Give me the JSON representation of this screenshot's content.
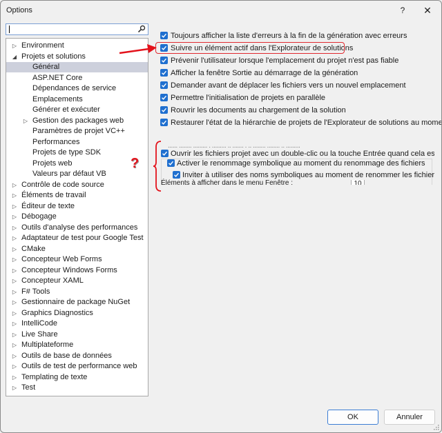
{
  "window": {
    "title": "Options",
    "help_label": "?",
    "close_label": "✕"
  },
  "search": {
    "value": "",
    "placeholder": "",
    "icon": "search-icon"
  },
  "tree": {
    "items": [
      {
        "label": "Environment",
        "level": 0,
        "expander": "collapsed"
      },
      {
        "label": "Projets et solutions",
        "level": 0,
        "expander": "expanded"
      },
      {
        "label": "Général",
        "level": 1,
        "expander": "none",
        "selected": true
      },
      {
        "label": "ASP.NET Core",
        "level": 1,
        "expander": "none"
      },
      {
        "label": "Dépendances de service",
        "level": 1,
        "expander": "none"
      },
      {
        "label": "Emplacements",
        "level": 1,
        "expander": "none"
      },
      {
        "label": "Générer et exécuter",
        "level": 1,
        "expander": "none"
      },
      {
        "label": "Gestion des packages web",
        "level": 1,
        "expander": "collapsed"
      },
      {
        "label": "Paramètres de projet VC++",
        "level": 1,
        "expander": "none"
      },
      {
        "label": "Performances",
        "level": 1,
        "expander": "none"
      },
      {
        "label": "Projets de type SDK",
        "level": 1,
        "expander": "none"
      },
      {
        "label": "Projets web",
        "level": 1,
        "expander": "none"
      },
      {
        "label": "Valeurs par défaut VB",
        "level": 1,
        "expander": "none"
      },
      {
        "label": "Contrôle de code source",
        "level": 0,
        "expander": "collapsed"
      },
      {
        "label": "Éléments de travail",
        "level": 0,
        "expander": "collapsed"
      },
      {
        "label": "Éditeur de texte",
        "level": 0,
        "expander": "collapsed"
      },
      {
        "label": "Débogage",
        "level": 0,
        "expander": "collapsed"
      },
      {
        "label": "Outils d'analyse des performances",
        "level": 0,
        "expander": "collapsed"
      },
      {
        "label": "Adaptateur de test pour Google Test",
        "level": 0,
        "expander": "collapsed"
      },
      {
        "label": "CMake",
        "level": 0,
        "expander": "collapsed"
      },
      {
        "label": "Concepteur Web Forms",
        "level": 0,
        "expander": "collapsed"
      },
      {
        "label": "Concepteur Windows Forms",
        "level": 0,
        "expander": "collapsed"
      },
      {
        "label": "Concepteur XAML",
        "level": 0,
        "expander": "collapsed"
      },
      {
        "label": "F# Tools",
        "level": 0,
        "expander": "collapsed"
      },
      {
        "label": "Gestionnaire de package NuGet",
        "level": 0,
        "expander": "collapsed"
      },
      {
        "label": "Graphics Diagnostics",
        "level": 0,
        "expander": "collapsed"
      },
      {
        "label": "IntelliCode",
        "level": 0,
        "expander": "collapsed"
      },
      {
        "label": "Live Share",
        "level": 0,
        "expander": "collapsed"
      },
      {
        "label": "Multiplateforme",
        "level": 0,
        "expander": "collapsed"
      },
      {
        "label": "Outils de base de données",
        "level": 0,
        "expander": "collapsed"
      },
      {
        "label": "Outils de test de performance web",
        "level": 0,
        "expander": "collapsed"
      },
      {
        "label": "Templating de texte",
        "level": 0,
        "expander": "collapsed"
      },
      {
        "label": "Test",
        "level": 0,
        "expander": "collapsed"
      }
    ]
  },
  "options": [
    {
      "label": "Toujours afficher la liste d'erreurs à la fin de la génération avec erreurs",
      "checked": true
    },
    {
      "label": "Suivre un élément actif dans l'Explorateur de solutions",
      "checked": true,
      "highlighted": true
    },
    {
      "label": "Prévenir l'utilisateur lorsque l'emplacement du projet n'est pas fiable",
      "checked": true
    },
    {
      "label": "Afficher la fenêtre Sortie au démarrage de la génération",
      "checked": true
    },
    {
      "label": "Demander avant de déplacer les fichiers vers un nouvel emplacement",
      "checked": true
    },
    {
      "label": "Permettre l'initialisation de projets en parallèle",
      "checked": true
    },
    {
      "label": "Rouvrir les documents au chargement de la solution",
      "checked": true
    },
    {
      "label": "Restaurer l'état de la hiérarchie de projets de l'Explorateur de solutions au moment du",
      "checked": true
    }
  ],
  "inner_panel": {
    "garbled_text": "...... ........ ......... . ......... .. ....... . .. ........ ........ .. .........",
    "options": [
      {
        "label": "Ouvrir les fichiers projet avec un double-clic ou la touche Entrée quand cela est pris e",
        "checked": true
      },
      {
        "label": "Activer le renommage symbolique au moment du renommage des fichiers",
        "checked": true
      },
      {
        "label": "Inviter à utiliser des noms symboliques au moment de renommer les fichiers",
        "checked": true
      }
    ],
    "window_menu_label": "Éléments à afficher dans le menu Fenêtre :",
    "window_menu_count": "10"
  },
  "annotations": {
    "question_mark": "?",
    "accent_color": "#e3121b"
  },
  "buttons": {
    "ok": "OK",
    "cancel": "Annuler"
  },
  "colors": {
    "checkbox": "#1f6fcf",
    "selection": "#cdd0dc",
    "background": "#f0f0f0",
    "highlight_border": "#e0282e"
  }
}
